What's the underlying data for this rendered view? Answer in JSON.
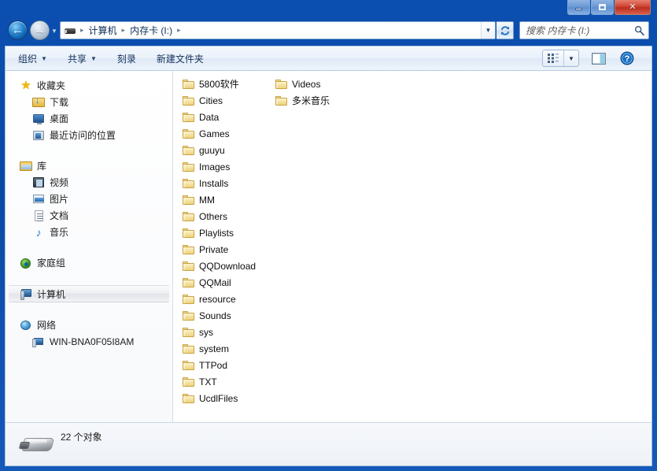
{
  "window": {
    "controls": {
      "minimize_label": "最小化",
      "maximize_label": "最大化",
      "close_label": "关闭",
      "close_glyph": "✕"
    }
  },
  "navigation": {
    "back_label": "后退",
    "back_glyph": "←",
    "forward_label": "前进",
    "forward_glyph": "→",
    "history_glyph": "▼"
  },
  "address": {
    "drive_icon": "removable-drive-icon",
    "crumbs": [
      {
        "label": "计算机"
      },
      {
        "label": "内存卡 (I:)"
      }
    ],
    "separator": "▸",
    "dropdown_glyph": "▼",
    "refresh_label": "刷新"
  },
  "search": {
    "placeholder": "搜索 内存卡 (I:)",
    "icon": "search-icon"
  },
  "toolbar": {
    "items": [
      {
        "label": "组织",
        "caret": "▼"
      },
      {
        "label": "共享",
        "caret": "▼"
      },
      {
        "label": "刻录",
        "caret": ""
      },
      {
        "label": "新建文件夹",
        "caret": ""
      }
    ],
    "view_caret": "▼",
    "view_label": "更改视图",
    "preview_label": "显示预览窗格",
    "help_label": "帮助",
    "help_glyph": "?"
  },
  "sidebar": {
    "groups": [
      {
        "header": {
          "label": "收藏夹",
          "icon": "star-icon"
        },
        "items": [
          {
            "label": "下载",
            "icon": "downloads-icon"
          },
          {
            "label": "桌面",
            "icon": "desktop-icon"
          },
          {
            "label": "最近访问的位置",
            "icon": "recent-places-icon"
          }
        ]
      },
      {
        "header": {
          "label": "库",
          "icon": "library-icon"
        },
        "items": [
          {
            "label": "视频",
            "icon": "video-icon"
          },
          {
            "label": "图片",
            "icon": "picture-icon"
          },
          {
            "label": "文档",
            "icon": "document-icon"
          },
          {
            "label": "音乐",
            "icon": "music-icon"
          }
        ]
      },
      {
        "header": {
          "label": "家庭组",
          "icon": "homegroup-icon"
        },
        "items": []
      },
      {
        "header": {
          "label": "计算机",
          "icon": "computer-icon",
          "selected": true
        },
        "items": []
      },
      {
        "header": {
          "label": "网络",
          "icon": "network-icon"
        },
        "items": [
          {
            "label": "WIN-BNA0F05I8AM",
            "icon": "network-computer-icon"
          }
        ]
      }
    ]
  },
  "filelist": {
    "items": [
      {
        "name": "5800软件",
        "icon": "folder-icon"
      },
      {
        "name": "Cities",
        "icon": "folder-icon"
      },
      {
        "name": "Data",
        "icon": "folder-icon"
      },
      {
        "name": "Games",
        "icon": "folder-icon"
      },
      {
        "name": "guuyu",
        "icon": "folder-icon"
      },
      {
        "name": "Images",
        "icon": "folder-icon"
      },
      {
        "name": "Installs",
        "icon": "folder-icon"
      },
      {
        "name": "MM",
        "icon": "folder-icon"
      },
      {
        "name": "Others",
        "icon": "folder-icon"
      },
      {
        "name": "Playlists",
        "icon": "folder-icon"
      },
      {
        "name": "Private",
        "icon": "folder-icon"
      },
      {
        "name": "QQDownload",
        "icon": "folder-icon"
      },
      {
        "name": "QQMail",
        "icon": "folder-icon"
      },
      {
        "name": "resource",
        "icon": "folder-icon"
      },
      {
        "name": "Sounds",
        "icon": "folder-icon"
      },
      {
        "name": "sys",
        "icon": "folder-icon"
      },
      {
        "name": "system",
        "icon": "folder-icon"
      },
      {
        "name": "TTPod",
        "icon": "folder-icon"
      },
      {
        "name": "TXT",
        "icon": "folder-icon"
      },
      {
        "name": "UcdlFiles",
        "icon": "folder-icon"
      },
      {
        "name": "Videos",
        "icon": "folder-icon"
      },
      {
        "name": "多米音乐",
        "icon": "folder-icon"
      }
    ]
  },
  "statusbar": {
    "icon": "usb-drive-icon",
    "text": "22 个对象"
  },
  "colors": {
    "titlebar_blue": "#0a4ba8",
    "close_red": "#cf4433",
    "folder_yellow": "#eed37f",
    "selection_gray": "#e1e4e8"
  }
}
